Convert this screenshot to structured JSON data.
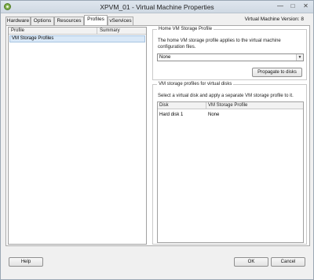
{
  "window": {
    "title": "XPVM_01 - Virtual Machine Properties",
    "controls": {
      "minimize": "—",
      "maximize": "□",
      "close": "✕"
    }
  },
  "tabs": [
    {
      "label": "Hardware",
      "active": false
    },
    {
      "label": "Options",
      "active": false
    },
    {
      "label": "Resources",
      "active": false
    },
    {
      "label": "Profiles",
      "active": true
    },
    {
      "label": "vServices",
      "active": false
    }
  ],
  "version_label": "Virtual Machine Version: 8",
  "profile_list": {
    "columns": [
      "Profile",
      "Summary"
    ],
    "rows": [
      {
        "profile": "VM Storage Profiles",
        "summary": ""
      }
    ]
  },
  "home_profile": {
    "legend": "Home VM Storage Profile",
    "description": "The home VM storage profile applies to the virtual machine configuration files.",
    "select_value": "None",
    "propagate_label": "Propagate to disks"
  },
  "disk_profiles": {
    "legend": "VM storage profiles for virtual disks",
    "description": "Select a virtual disk and apply a separate VM storage profile to it.",
    "columns": [
      "Disk",
      "VM Storage Profile"
    ],
    "rows": [
      {
        "disk": "Hard disk 1",
        "profile": "None"
      }
    ]
  },
  "footer": {
    "help": "Help",
    "ok": "OK",
    "cancel": "Cancel"
  },
  "icons": {
    "app": "vm-properties-icon",
    "dropdown": "chevron-down-icon"
  }
}
